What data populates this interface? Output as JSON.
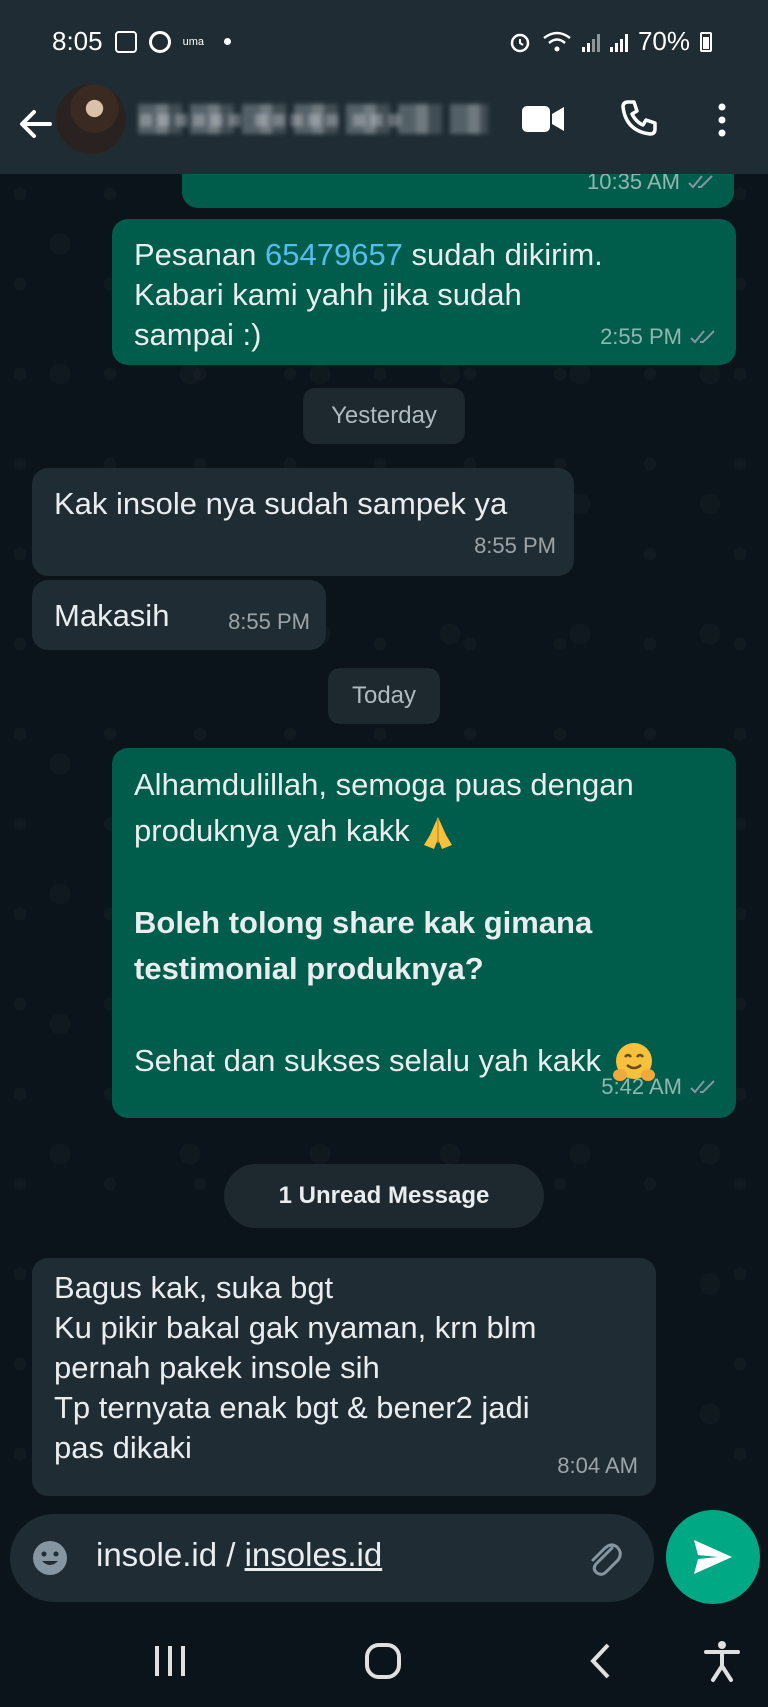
{
  "status_bar": {
    "time": "8:05",
    "app_label": "uma",
    "battery": "70%"
  },
  "header": {
    "contact_name": "■■■■■■ ■■■■■ ■■■"
  },
  "messages": [
    {
      "direction": "outgoing",
      "text": "",
      "time": "10:35 AM"
    },
    {
      "direction": "outgoing",
      "text_prefix": "Pesanan ",
      "link": "65479657",
      "text_suffix": " sudah dikirim.",
      "line2": "Kabari kami yahh jika sudah",
      "line3": "sampai :)",
      "time": "2:55 PM"
    },
    {
      "direction": "incoming",
      "text": "Kak insole nya sudah sampek ya",
      "time": "8:55 PM"
    },
    {
      "direction": "incoming",
      "text": "Makasih",
      "time": "8:55 PM"
    },
    {
      "direction": "outgoing",
      "line1": "Alhamdulillah, semoga puas dengan",
      "line2": "produknya yah kakk",
      "bold1": "Boleh tolong share kak gimana",
      "bold2": "testimonial produknya?",
      "line3": "Sehat dan sukses selalu yah kakk",
      "time": "5:42 AM"
    },
    {
      "direction": "incoming",
      "line1": "Bagus kak, suka bgt",
      "line2": "Ku pikir bakal gak nyaman, krn blm",
      "line3": "pernah pakek insole sih",
      "line4": "Tp ternyata enak bgt & bener2 jadi",
      "line5": "pas dikaki",
      "time": "8:04 AM"
    }
  ],
  "date_separators": {
    "yesterday": "Yesterday",
    "today": "Today"
  },
  "unread_banner": "1 Unread Message",
  "composer": {
    "text_plain": "insole.id / ",
    "text_underlined": "insoles.id"
  },
  "colors": {
    "outgoing_bubble": "#005c4b",
    "incoming_bubble": "#202c33",
    "accent": "#00a884",
    "link": "#53bdeb"
  }
}
